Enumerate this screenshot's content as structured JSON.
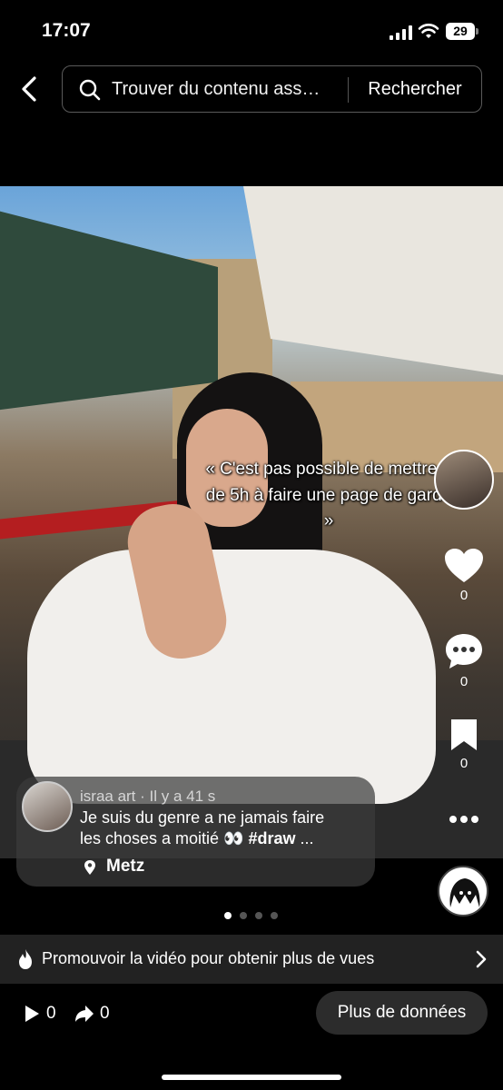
{
  "status_bar": {
    "time": "17:07",
    "battery": "29"
  },
  "search": {
    "query": "Trouver du contenu ass…",
    "button_label": "Rechercher"
  },
  "post": {
    "caption": "« C'est pas possible de mettre + de 5h à faire une page de garde »",
    "author_line": "israa art · Il y a 41 s",
    "description_line1": "Je suis du genre a ne jamais faire",
    "description_line2_text": "les choses a moitié 👀 ",
    "description_hashtag": "#draw",
    "description_ellipsis": " ...",
    "location": "Metz"
  },
  "rail": {
    "likes": "0",
    "comments": "0",
    "saves": "0"
  },
  "promote": {
    "label": "Promouvoir la vidéo pour obtenir plus de vues"
  },
  "stats": {
    "plays": "0",
    "shares": "0",
    "more_data_label": "Plus de données"
  },
  "colors": {
    "background": "#000000",
    "panel": "#222222",
    "pill": "#2c2c2c"
  }
}
